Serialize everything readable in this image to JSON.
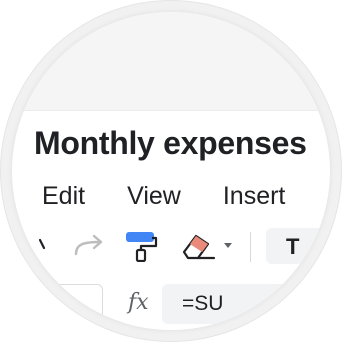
{
  "document": {
    "title": "Monthly expenses"
  },
  "menu": {
    "items": [
      "Edit",
      "View",
      "Insert"
    ]
  },
  "toolbar": {
    "icons": [
      "undo-icon",
      "redo-icon",
      "paint-format-icon",
      "clear-formatting-icon"
    ],
    "text_format_label": "T",
    "accent_color": "#4285f4",
    "eraser_color": "#ea8a7a"
  },
  "formula_bar": {
    "fx_label": "fx",
    "value": "=SU"
  }
}
